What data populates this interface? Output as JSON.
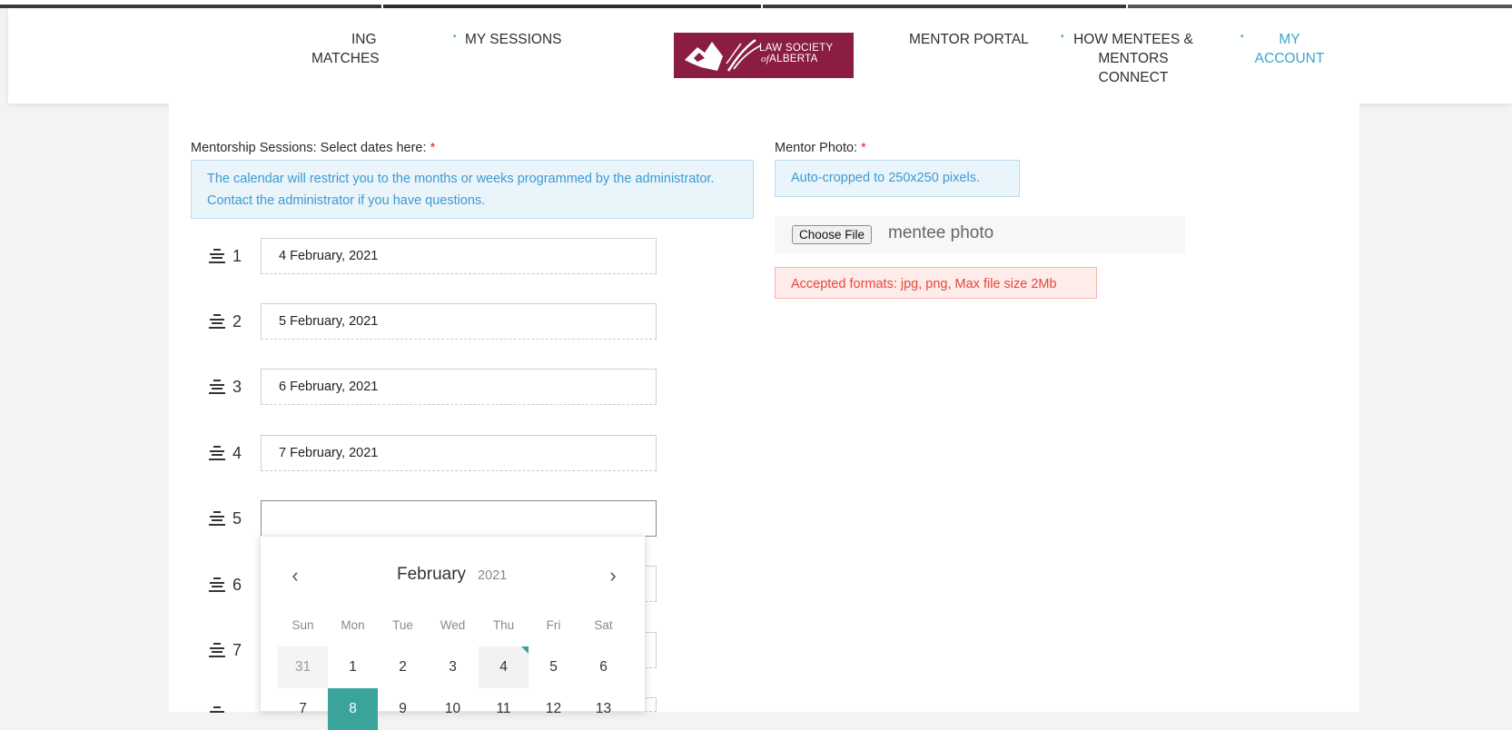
{
  "nav": {
    "matches_line1": "ING",
    "matches_line2": "MATCHES",
    "my_sessions": "MY SESSIONS",
    "mentor_portal": "MENTOR PORTAL",
    "how_line1": "HOW MENTEES &",
    "how_line2": "MENTORS",
    "how_line3": "CONNECT",
    "account_line1": "MY",
    "account_line2": "ACCOUNT",
    "bullet": "•"
  },
  "logo": {
    "line1": "LAW SOCIETY",
    "line2_prefix": "of",
    "line2": "ALBERTA",
    "brand_color": "#8b1d45"
  },
  "sessions": {
    "label": "Mentorship Sessions: Select dates here:",
    "required_mark": "*",
    "info": "The calendar will restrict you to the months or weeks programmed by the administrator. Contact the administrator if you have questions.",
    "rows": [
      {
        "num": "1",
        "value": "4 February, 2021"
      },
      {
        "num": "2",
        "value": "5 February, 2021"
      },
      {
        "num": "3",
        "value": "6 February, 2021"
      },
      {
        "num": "4",
        "value": "7 February, 2021"
      },
      {
        "num": "5",
        "value": ""
      },
      {
        "num": "6",
        "value": ""
      },
      {
        "num": "7",
        "value": ""
      }
    ]
  },
  "photo": {
    "label": "Mentor Photo:",
    "required_mark": "*",
    "info": "Auto-cropped to 250x250 pixels.",
    "choose_button": "Choose File",
    "file_name": "mentee photo",
    "formats_note": "Accepted formats: jpg, png, Max file size 2Mb"
  },
  "calendar": {
    "month": "February",
    "year": "2021",
    "prev_icon": "‹",
    "next_icon": "›",
    "weekdays": [
      "Sun",
      "Mon",
      "Tue",
      "Wed",
      "Thu",
      "Fri",
      "Sat"
    ],
    "week1": [
      "31",
      "1",
      "2",
      "3",
      "4",
      "5",
      "6"
    ],
    "week2": [
      "7",
      "8",
      "9",
      "10",
      "11",
      "12",
      "13"
    ],
    "selected_day": "8",
    "accent_color": "#3aa39a"
  },
  "colors": {
    "link_active": "#3aa6cf",
    "required": "#e02424"
  }
}
